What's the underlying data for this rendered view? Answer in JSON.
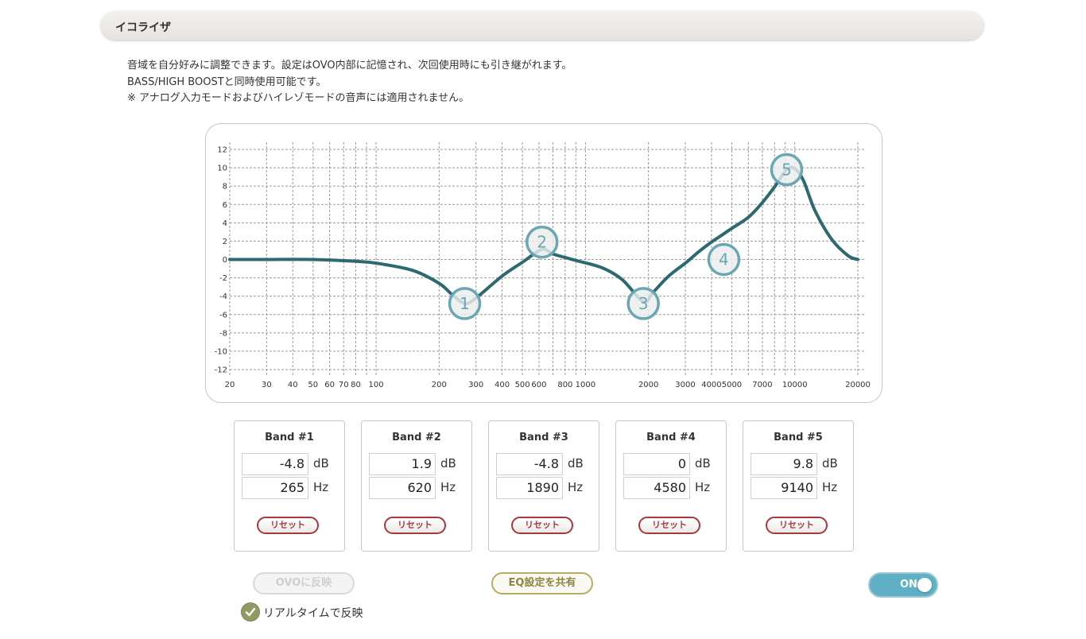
{
  "header": {
    "title": "イコライザ"
  },
  "description": {
    "line1": "音域を自分好みに調整できます。設定はOVO内部に記憶され、次回使用時にも引き継がれます。",
    "line2": "BASS/HIGH BOOSTと同時使用可能です。",
    "line3": "※ アナログ入力モードおよびハイレゾモードの音声には適用されません。"
  },
  "chart_data": {
    "type": "line",
    "x_scale": "log",
    "xlim": [
      20,
      20000
    ],
    "ylim": [
      -12,
      12
    ],
    "x_tick_labels": [
      "20",
      "30",
      "40",
      "50",
      "60",
      "70",
      "80",
      "100",
      "200",
      "300",
      "400",
      "500",
      "600",
      "800",
      "1000",
      "2000",
      "3000",
      "4000",
      "5000",
      "7000",
      "10000",
      "20000"
    ],
    "y_tick_labels": [
      "12",
      "10",
      "8",
      "6",
      "4",
      "2",
      "0",
      "-2",
      "-4",
      "-6",
      "-8",
      "-10",
      "-12"
    ],
    "grid": true,
    "curve_color": "#2c6a70",
    "handle_color": "#6aa7b4",
    "curve": {
      "x": [
        20,
        30,
        50,
        80,
        100,
        150,
        200,
        230,
        265,
        300,
        400,
        500,
        620,
        700,
        900,
        1200,
        1500,
        1890,
        2100,
        2500,
        3000,
        3500,
        4000,
        4580,
        5000,
        6000,
        7000,
        8000,
        9140,
        10000,
        11000,
        12500,
        15000,
        18000,
        20000
      ],
      "y": [
        0,
        0,
        0,
        -0.2,
        -0.4,
        -1.2,
        -2.6,
        -3.8,
        -4.8,
        -4.2,
        -1.8,
        -0.3,
        1.1,
        0.6,
        -0.1,
        -0.9,
        -2.2,
        -4.6,
        -3.6,
        -1.8,
        -0.4,
        0.9,
        1.9,
        2.8,
        3.4,
        4.6,
        6.2,
        7.9,
        9.8,
        9.9,
        8.6,
        5.3,
        2.2,
        0.4,
        0
      ]
    },
    "bands": [
      {
        "label": "1",
        "freq": 265,
        "gain": -4.8
      },
      {
        "label": "2",
        "freq": 620,
        "gain": 1.9
      },
      {
        "label": "3",
        "freq": 1890,
        "gain": -4.8
      },
      {
        "label": "4",
        "freq": 4580,
        "gain": 0
      },
      {
        "label": "5",
        "freq": 9140,
        "gain": 9.8
      }
    ]
  },
  "bands": [
    {
      "title": "Band #1",
      "gain": "-4.8",
      "freq": "265",
      "reset": "リセット"
    },
    {
      "title": "Band #2",
      "gain": "1.9",
      "freq": "620",
      "reset": "リセット"
    },
    {
      "title": "Band #3",
      "gain": "-4.8",
      "freq": "1890",
      "reset": "リセット"
    },
    {
      "title": "Band #4",
      "gain": "0",
      "freq": "4580",
      "reset": "リセット"
    },
    {
      "title": "Band #5",
      "gain": "9.8",
      "freq": "9140",
      "reset": "リセット"
    }
  ],
  "units": {
    "db": "dB",
    "hz": "Hz"
  },
  "actions": {
    "ovo_apply": "OVOに反映",
    "share": "EQ設定を共有",
    "realtime": "リアルタイムで反映",
    "realtime_checked": true,
    "power": "ON",
    "power_on": true
  }
}
